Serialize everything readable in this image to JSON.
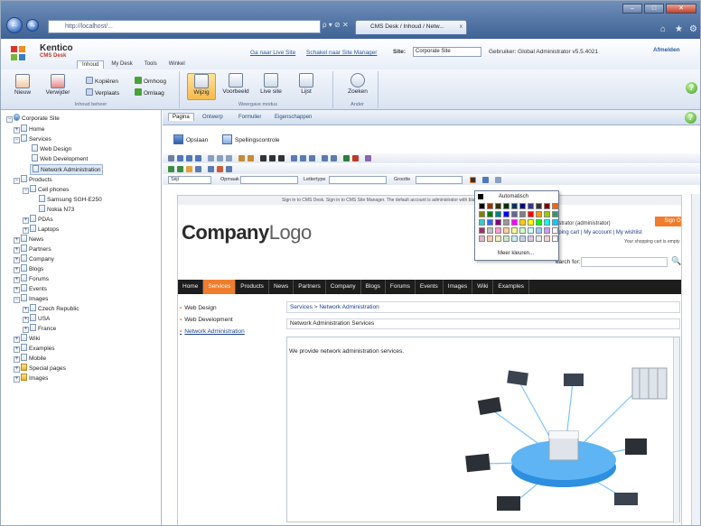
{
  "browser": {
    "address": "http://localhost/...",
    "tab_label": "CMS Desk / Inhoud / Netw...",
    "nav_back": "←",
    "nav_forward": "→",
    "tab_close": "x",
    "addr_icons": "ρ ▾ ⊘ ✕",
    "win_min": "–",
    "win_max": "□",
    "win_close": "✕"
  },
  "header": {
    "logo_name": "Kentico",
    "logo_sub": "CMS Desk",
    "links": [
      "Ga naar Live Site",
      "Schakel naar Site Manager"
    ],
    "site_label": "Site:",
    "site_value": "Corporate Site",
    "user_text": "Gebruiker: Global Administrator v5.5.4021",
    "logout": "Afmelden",
    "menutabs": [
      "Inhoud",
      "My Desk",
      "Tools",
      "Winkel"
    ]
  },
  "ribbon": {
    "new": "Nieuw",
    "delete": "Verwijder",
    "copy": "Kopiëren",
    "move": "Verplaats",
    "up": "Omhoog",
    "down": "Omlaag",
    "group1": "Inhoud beheer",
    "edit": "Wijzig",
    "preview": "Voorbeeld",
    "livesite": "Live site",
    "list": "Lijst",
    "group2": "Weergave modus",
    "search": "Zoeken",
    "group3": "Ander"
  },
  "tree": {
    "root": "Corporate Site",
    "items": [
      "Home",
      "Services",
      "Web Design",
      "Web Development",
      "Network Administration",
      "Products",
      "Cell phones",
      "Samsung SGH-E250",
      "Nokia N73",
      "PDAs",
      "Laptops",
      "News",
      "Partners",
      "Company",
      "Blogs",
      "Forums",
      "Events",
      "Images",
      "Czech Republic",
      "USA",
      "France",
      "Wiki",
      "Examples",
      "Mobile",
      "Special pages",
      "Images"
    ]
  },
  "main": {
    "tabs": [
      "Pagina",
      "Ontwerp",
      "Formulier",
      "Eigenschappen"
    ],
    "save": "Opslaan",
    "spellcheck": "Spellingscontrole",
    "toolbar_style_value": "Stijl",
    "toolbar_format": "Opmaak",
    "toolbar_font": "Lettertype",
    "toolbar_size": "Grootte"
  },
  "preview": {
    "signin_text": "Sign in to CMS Desk. Sign in to CMS Site Manager. The default account is administrator with blank password.",
    "logo_part1": "Company",
    "logo_part2": "Logo",
    "user_greeting": "istrator (administrator)",
    "signout": "Sign Out",
    "shop_links": "pping cart | My account | My wishlist",
    "cart_note": "Your shopping cart is empty",
    "search_label": "earch for:",
    "nav": [
      "Home",
      "Services",
      "Products",
      "News",
      "Partners",
      "Company",
      "Blogs",
      "Forums",
      "Events",
      "Images",
      "Wiki",
      "Examples"
    ],
    "leftnav": [
      "Web Design",
      "Web Development",
      "Network Administration"
    ],
    "breadcrumb": "Services > Network Administration",
    "page_title": "Network Administration Services",
    "body_text": "We provide network administration services."
  },
  "colorpicker": {
    "auto": "Automatisch",
    "more": "Meer kleuren...",
    "colors": [
      "#000000",
      "#993300",
      "#333300",
      "#003300",
      "#003366",
      "#000080",
      "#333399",
      "#333333",
      "#800000",
      "#ff6600",
      "#808000",
      "#008000",
      "#008080",
      "#0000ff",
      "#666699",
      "#808080",
      "#ff0000",
      "#ff9900",
      "#99cc00",
      "#339966",
      "#33cccc",
      "#3366ff",
      "#800080",
      "#969696",
      "#ff00ff",
      "#ffcc00",
      "#ffff00",
      "#00ff00",
      "#00ffff",
      "#00ccff",
      "#993366",
      "#c0c0c0",
      "#ff99cc",
      "#ffcc99",
      "#ffff99",
      "#ccffcc",
      "#ccffff",
      "#99ccff",
      "#cc99ff",
      "#ffffff",
      "#e4b3c7",
      "#f7c9a6",
      "#f2efb5",
      "#c9e9c4",
      "#c6ecee",
      "#bcd6f2",
      "#d9c6ef",
      "#eaeaea",
      "#f2d1d1",
      "#fafafa"
    ]
  }
}
